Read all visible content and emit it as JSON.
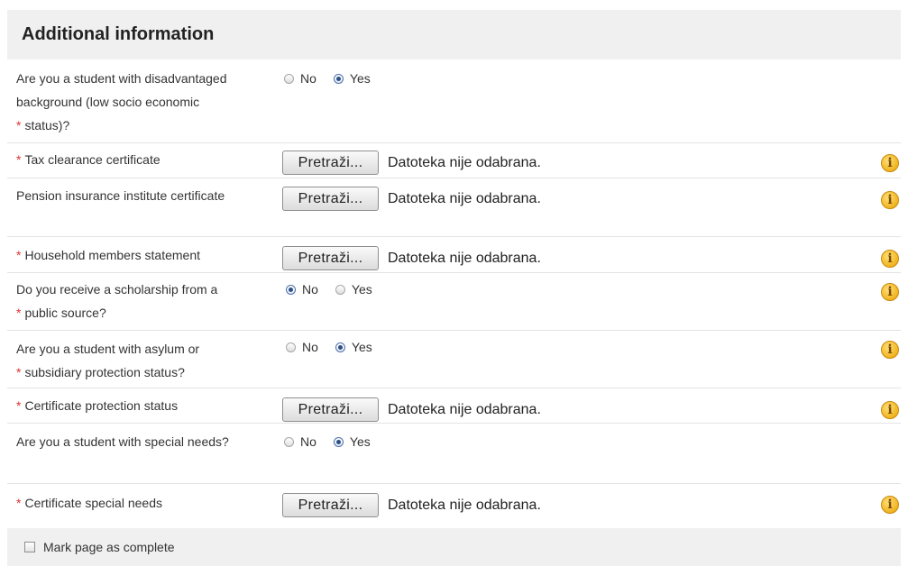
{
  "section": {
    "title": "Additional information"
  },
  "common": {
    "required_mark": "*",
    "browse_label": "Pretraži...",
    "no_file_text": "Datoteka nije odabrana.",
    "radio_no": "No",
    "radio_yes": "Yes",
    "info_glyph": "i"
  },
  "questions": {
    "disadvantaged": {
      "label_lines": [
        "Are you a student with disadvantaged",
        "background (low socio economic",
        "status)?"
      ],
      "selected": "Yes"
    },
    "tax_clearance": {
      "label": "Tax clearance certificate"
    },
    "pension": {
      "label": "Pension insurance institute certificate"
    },
    "household": {
      "label": "Household members statement"
    },
    "scholarship": {
      "label_lines": [
        "Do you receive a scholarship from a",
        "public source?"
      ],
      "selected": "No"
    },
    "asylum": {
      "label_lines": [
        "Are you a student with asylum or",
        "subsidiary protection status?"
      ],
      "selected": "Yes"
    },
    "protection_cert": {
      "label": "Certificate protection status"
    },
    "special_needs": {
      "label": "Are you a student with special needs?",
      "selected": "Yes"
    },
    "special_needs_cert": {
      "label": "Certificate special needs"
    }
  },
  "footer": {
    "mark_complete_label": "Mark page as complete",
    "checked": false
  },
  "colors": {
    "required": "#dd3333",
    "header_bg": "#f0f0f0",
    "info_icon": "#f0b41e"
  }
}
